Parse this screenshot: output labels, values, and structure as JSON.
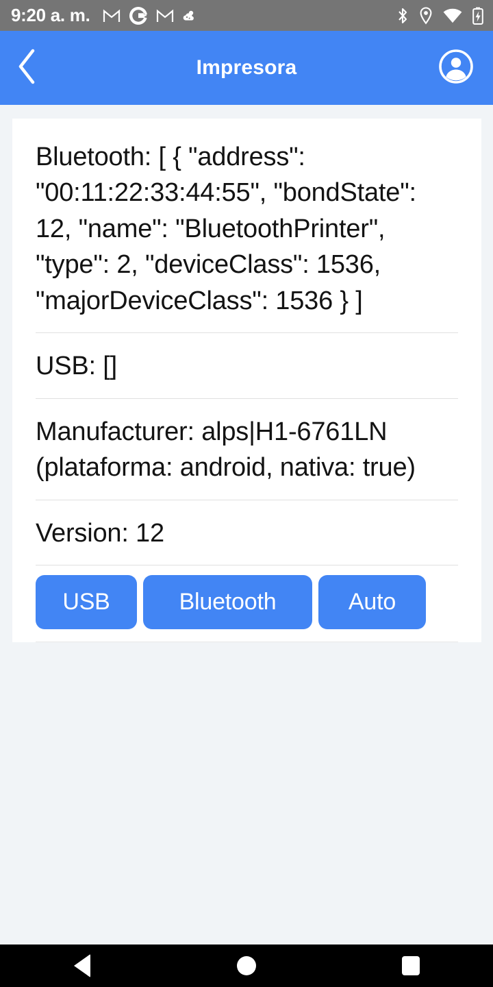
{
  "status_bar": {
    "time": "9:20 a. m.",
    "left_icons": [
      "gmail-icon",
      "google-icon",
      "gmail-icon",
      "weather-cloud-icon"
    ],
    "right_icons": [
      "bluetooth-icon",
      "location-pin-icon",
      "wifi-icon",
      "battery-charging-icon"
    ],
    "background_color": "#757575"
  },
  "app_bar": {
    "back_icon": "chevron-left-icon",
    "title": "Impresora",
    "account_icon": "account-circle-icon",
    "background_color": "#4285f4"
  },
  "card": {
    "rows": [
      {
        "key": "Bluetooth",
        "text": "Bluetooth: [ { \"address\": \"00:11:22:33:44:55\", \"bondState\": 12, \"name\": \"BluetoothPrinter\", \"type\": 2, \"deviceClass\": 1536, \"majorDeviceClass\": 1536 } ]"
      },
      {
        "key": "USB",
        "text": "USB: []"
      },
      {
        "key": "Manufacturer",
        "text": "Manufacturer: alps|H1-6761LN (plataforma: android, nativa: true)"
      },
      {
        "key": "Version",
        "text": "Version: 12"
      }
    ],
    "buttons": [
      {
        "label": "USB"
      },
      {
        "label": "Bluetooth"
      },
      {
        "label": "Auto"
      }
    ],
    "button_color": "#4285f4",
    "background_color": "#ffffff"
  },
  "page": {
    "background_color": "#f1f4f7"
  },
  "nav_bar": {
    "back_icon": "nav-back-triangle-icon",
    "home_icon": "nav-home-circle-icon",
    "recents_icon": "nav-recents-square-icon",
    "background_color": "#000000"
  }
}
